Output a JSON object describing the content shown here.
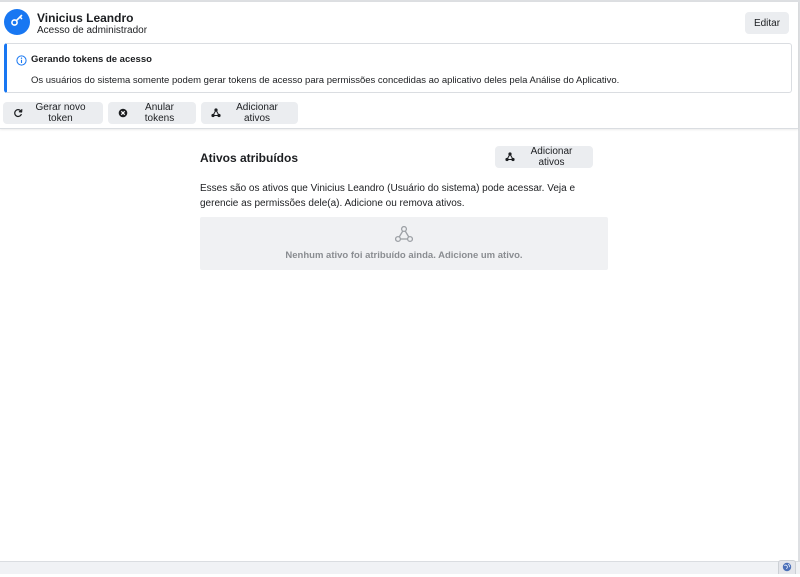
{
  "header": {
    "user_name": "Vinicius Leandro",
    "user_role": "Acesso de administrador",
    "edit_label": "Editar"
  },
  "notice": {
    "title": "Gerando tokens de acesso",
    "text": "Os usuários do sistema somente podem gerar tokens de acesso para permissões concedidas ao aplicativo deles pela Análise do Aplicativo."
  },
  "toolbar": {
    "generate_token_label": "Gerar novo token",
    "revoke_tokens_label": "Anular tokens",
    "add_assets_label": "Adicionar ativos"
  },
  "assets": {
    "title": "Ativos atribuídos",
    "add_assets_label": "Adicionar ativos",
    "description": "Esses são os ativos que Vinicius Leandro (Usuário do sistema) pode acessar. Veja e gerencie as permissões dele(a). Adicione ou remova ativos.",
    "empty_text": "Nenhum ativo foi atribuído ainda. Adicione um ativo."
  },
  "colors": {
    "accent": "#1877f2",
    "button_bg": "#ebedf0",
    "empty_bg": "#f0f1f3",
    "muted_text": "#8a8d91"
  },
  "icons": {
    "avatar": "key-icon",
    "notice": "info-icon",
    "generate": "refresh-icon",
    "revoke": "close-circle-icon",
    "assets": "nodes-icon",
    "footer": "globe-icon"
  }
}
